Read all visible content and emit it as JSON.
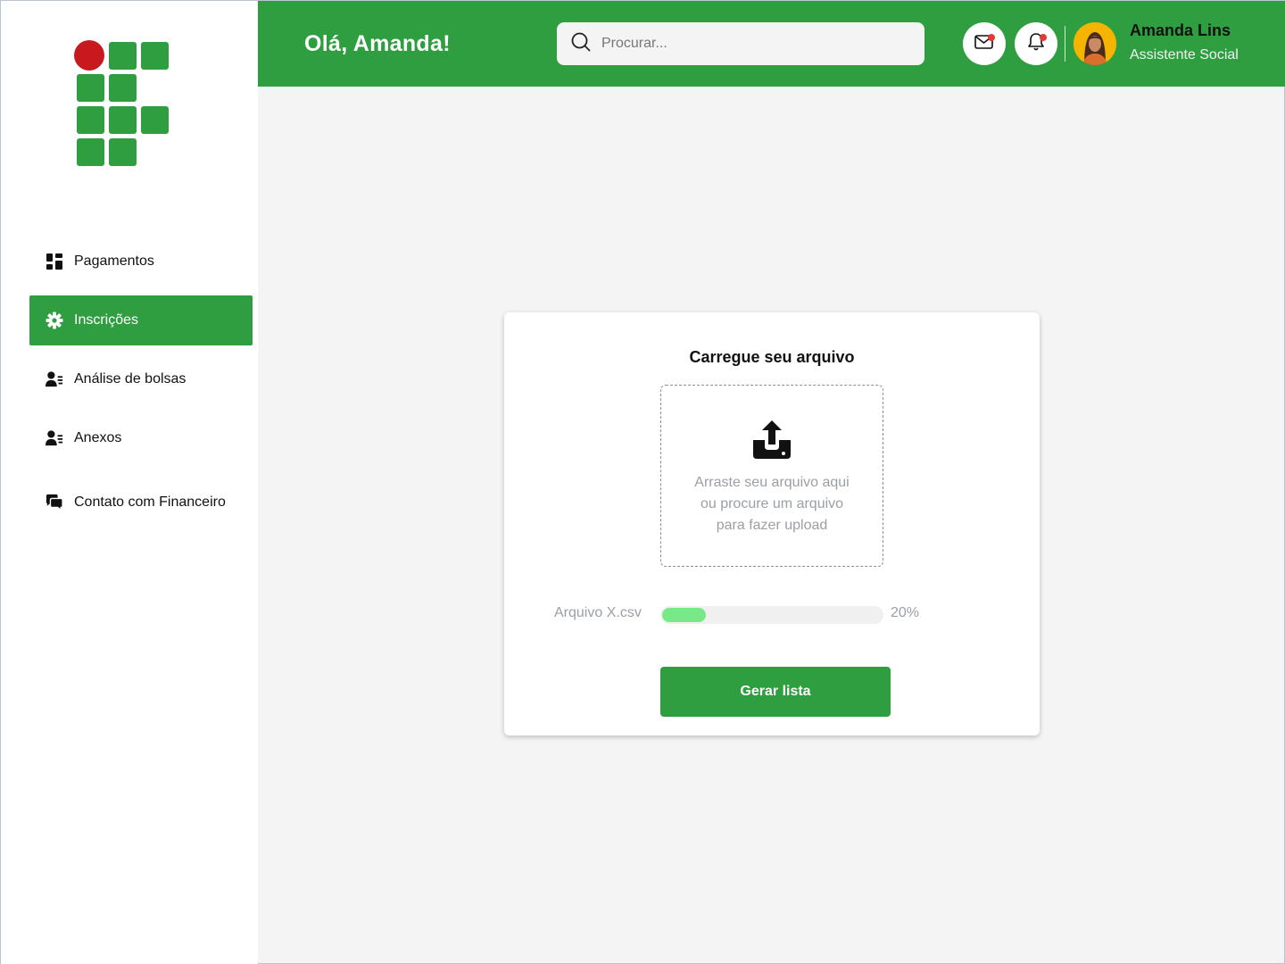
{
  "colors": {
    "brand_green": "#2f9e41",
    "logo_red": "#c8191f",
    "progress_fill": "#79e886",
    "notification_dot": "#e53935"
  },
  "sidebar": {
    "items": [
      {
        "label": "Pagamentos",
        "icon": "dashboard-grid-icon",
        "active": false
      },
      {
        "label": "Inscrições",
        "icon": "gear-icon",
        "active": true
      },
      {
        "label": "Análise de bolsas",
        "icon": "user-list-icon",
        "active": false
      },
      {
        "label": "Anexos",
        "icon": "user-list-icon",
        "active": false
      },
      {
        "label": "Contato com Financeiro",
        "icon": "chat-bubbles-icon",
        "active": false
      }
    ]
  },
  "header": {
    "greeting": "Olá, Amanda!",
    "search_placeholder": "Procurar...",
    "icons": {
      "search": "search-icon",
      "mail": "mail-icon",
      "bell": "bell-icon"
    },
    "user": {
      "name": "Amanda Lins",
      "role": "Assistente Social"
    }
  },
  "upload": {
    "title": "Carregue seu arquivo",
    "icon": "upload-icon",
    "dropzone_lines": [
      "Arraste seu arquivo aqui",
      "ou procure um arquivo",
      "para fazer upload"
    ],
    "file_name": "Arquivo X.csv",
    "progress_percent": 20,
    "progress_label": "20%",
    "button_label": "Gerar lista"
  }
}
